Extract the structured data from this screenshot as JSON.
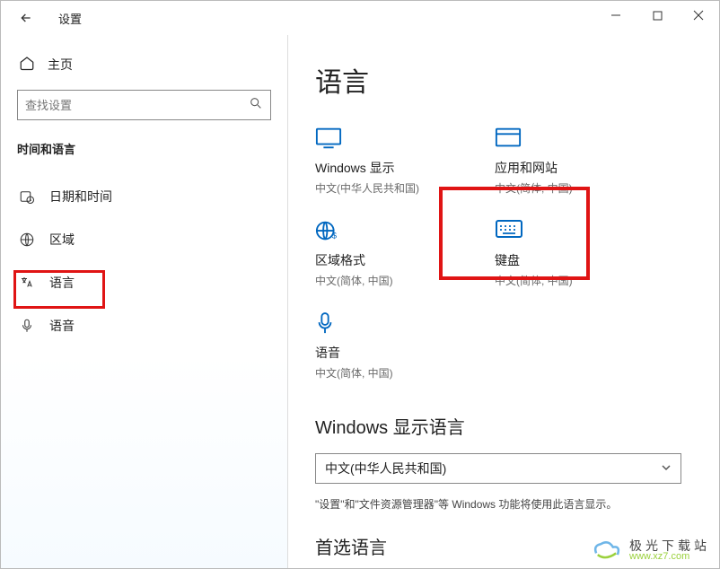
{
  "window": {
    "title": "设置"
  },
  "sidebar": {
    "home": "主页",
    "search_placeholder": "查找设置",
    "section": "时间和语言",
    "items": [
      {
        "label": "日期和时间"
      },
      {
        "label": "区域"
      },
      {
        "label": "语言"
      },
      {
        "label": "语音"
      }
    ]
  },
  "main": {
    "heading": "语言",
    "tiles": [
      {
        "label": "Windows 显示",
        "sub": "中文(中华人民共和国)"
      },
      {
        "label": "应用和网站",
        "sub": "中文(简体, 中国)"
      },
      {
        "label": "区域格式",
        "sub": "中文(简体, 中国)"
      },
      {
        "label": "键盘",
        "sub": "中文(简体, 中国)"
      },
      {
        "label": "语音",
        "sub": "中文(简体, 中国)"
      }
    ],
    "display_lang_heading": "Windows 显示语言",
    "display_lang_value": "中文(中华人民共和国)",
    "display_lang_help": "\"设置\"和\"文件资源管理器\"等 Windows 功能将使用此语言显示。",
    "preferred_heading": "首选语言"
  },
  "watermark": {
    "brand": "极光下载站",
    "url": "www.xz7.com"
  }
}
